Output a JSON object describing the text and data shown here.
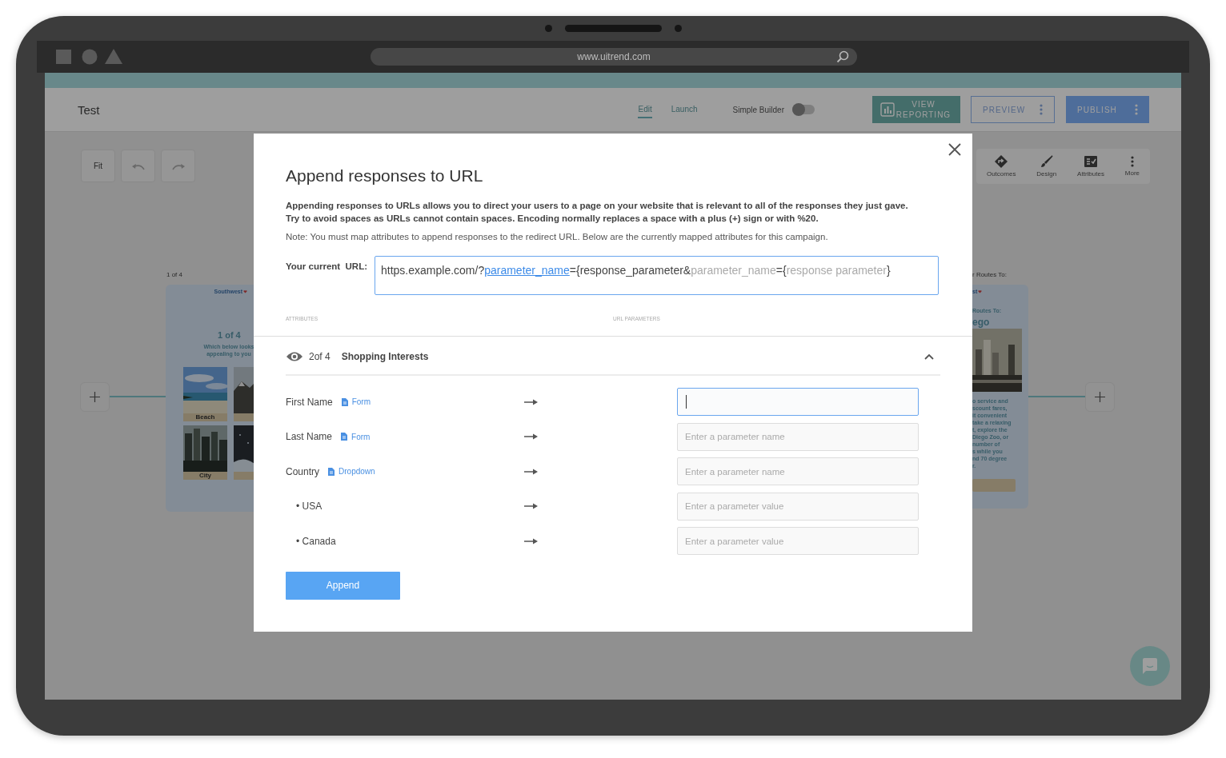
{
  "browser": {
    "url": "www.uitrend.com"
  },
  "header": {
    "title": "Test",
    "tabs": [
      {
        "label": "Edit",
        "selected": true
      },
      {
        "label": "Launch",
        "selected": false
      }
    ],
    "simple_builder": {
      "label": "Simple Builder",
      "on": false
    },
    "buttons": [
      {
        "kind": "reporting",
        "label": "VIEW REPORTING"
      },
      {
        "kind": "outline",
        "label": "PREVIEW"
      },
      {
        "kind": "primary",
        "label": "PUBLISH"
      }
    ]
  },
  "canvas": {
    "view_tools": [
      {
        "kind": "fit",
        "label": "Fit"
      },
      {
        "kind": "undo"
      },
      {
        "kind": "redo"
      }
    ],
    "panel_tools": [
      {
        "kind": "outcomes",
        "label": "Outcomes"
      },
      {
        "kind": "design",
        "label": "Design"
      },
      {
        "kind": "attributes",
        "label": "Attributes"
      },
      {
        "kind": "more",
        "label": "More"
      }
    ],
    "first_card": {
      "caption": "1 of 4",
      "brand": "Southwest",
      "heading": "1 of 4",
      "question_lines": [
        "Which below looks",
        "appealing to you"
      ],
      "tiles": [
        {
          "kind": "beach",
          "label": "Beach"
        },
        {
          "kind": "city",
          "label": "City"
        }
      ]
    },
    "last_card": {
      "caption": "r Routes To:",
      "brand": "st",
      "subheading": "Routes To:",
      "heading": "ego",
      "body_lines": [
        "o service and",
        "scount fares,",
        "it convenient",
        "take a relaxing",
        "t, explore the",
        "Diego Zoo, or",
        "number of",
        "s while you",
        "nd 70 degree",
        "r."
      ]
    }
  },
  "modal": {
    "title": "Append responses to URL",
    "description": [
      "Appending responses to URLs allows you to direct your users to a page on your website that is relevant to all of the responses they just gave.",
      "Try to avoid spaces as URLs cannot contain spaces. Encoding normally replaces a space with a plus (+) sign or with %20."
    ],
    "note": "Note: You must map attributes to append responses to the redirect URL. Below are the currently mapped attributes for this campaign.",
    "url_label": "Your current  URL:",
    "url_parts": [
      {
        "kind": "text",
        "text": "https.example.com/?"
      },
      {
        "kind": "param",
        "text": "parameter_name"
      },
      {
        "kind": "text",
        "text": "={response_parameter&"
      },
      {
        "kind": "hint",
        "text": "parameter_name"
      },
      {
        "kind": "text",
        "text": "={"
      },
      {
        "kind": "hint",
        "text": "response parameter"
      },
      {
        "kind": "text",
        "text": "}"
      }
    ],
    "columns": [
      "ATTRIBUTES",
      "URL PARAMETERS"
    ],
    "section": {
      "step": "2of 4",
      "title": "Shopping Interests",
      "expanded": true
    },
    "rows": [
      {
        "kind": "attribute",
        "label": "First Name",
        "type": "Form",
        "focused": true
      },
      {
        "kind": "attribute",
        "label": "Last Name",
        "type": "Form",
        "placeholder": "Enter a parameter name",
        "focused": false
      },
      {
        "kind": "attribute",
        "label": "Country",
        "type": "Dropdown",
        "placeholder": "Enter a parameter name",
        "focused": false
      },
      {
        "kind": "option",
        "label": "• USA",
        "placeholder": "Enter a parameter value",
        "focused": false
      },
      {
        "kind": "option",
        "label": "• Canada",
        "placeholder": "Enter a parameter value",
        "focused": false
      }
    ],
    "append_button": "Append"
  }
}
